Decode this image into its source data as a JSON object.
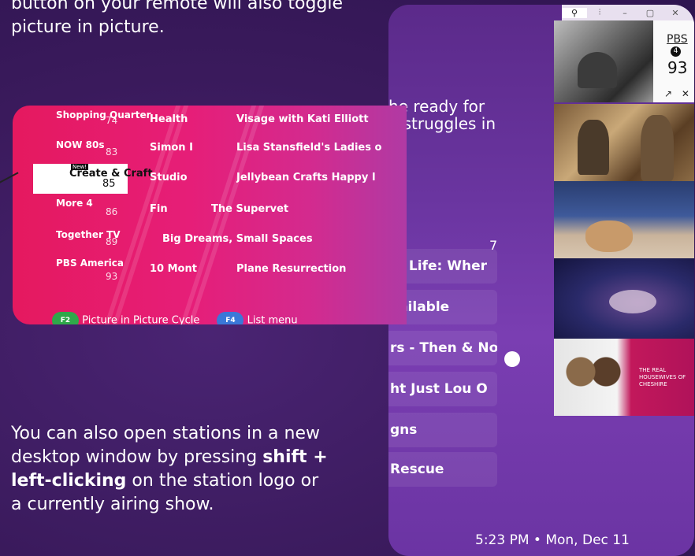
{
  "tutorial": {
    "top_text": "button on your remote will also toggle picture in picture.",
    "bottom_text_before": "You can also open stations in a new desktop window by pressing ",
    "bottom_text_bold": "shift + left-clicking",
    "bottom_text_after": " on the station logo or a currently airing show."
  },
  "guide": {
    "rows": [
      {
        "channel": "Shopping Quarter",
        "number": "74",
        "show1": "Health",
        "show2": "Visage with Kati Elliott"
      },
      {
        "channel": "NOW 80s",
        "number": "83",
        "show1": "Simon I",
        "show2": "Lisa Stansfield's Ladies o"
      },
      {
        "channel": "Create & Craft",
        "number": "85",
        "show1": "Studio",
        "show2": "Jellybean Crafts Happy I"
      },
      {
        "channel": "More 4",
        "number": "86",
        "show1": "Fin",
        "show2": "The Supervet"
      },
      {
        "channel": "Together TV",
        "number": "89",
        "show1": "",
        "show2": "Big Dreams, Small Spaces"
      },
      {
        "channel": "PBS America",
        "number": "93",
        "show1": "10 Mont",
        "show2": "Plane Resurrection"
      }
    ],
    "selected_badge": "New!",
    "footer_key1": "F2",
    "footer_label1": "Picture in Picture Cycle",
    "footer_key2": "F4",
    "footer_label2": "List menu",
    "colors": {
      "key1": "#2fa84a",
      "key2": "#3a78d8",
      "accent": "#e5195f"
    }
  },
  "window": {
    "title_icons": [
      "pin-icon",
      "sliders-icon",
      "minimize-icon",
      "maximize-icon"
    ],
    "mid_text_line1": "he ready for",
    "mid_text_line2": "a struggles in",
    "number": "7",
    "rows": [
      "lb Life: Wher",
      "vailable",
      "rs - Then & No",
      "ht Just Lou O",
      "gns",
      "Rescue"
    ],
    "clock": "5:23 PM • Mon, Dec 11"
  },
  "pip": {
    "channel_logo": "PBS",
    "channel_number": "93",
    "badge": "4",
    "popout": "↗",
    "close": "✕",
    "thumb5_tag": "THE REAL HOUSEWIVES OF CHESHIRE"
  }
}
